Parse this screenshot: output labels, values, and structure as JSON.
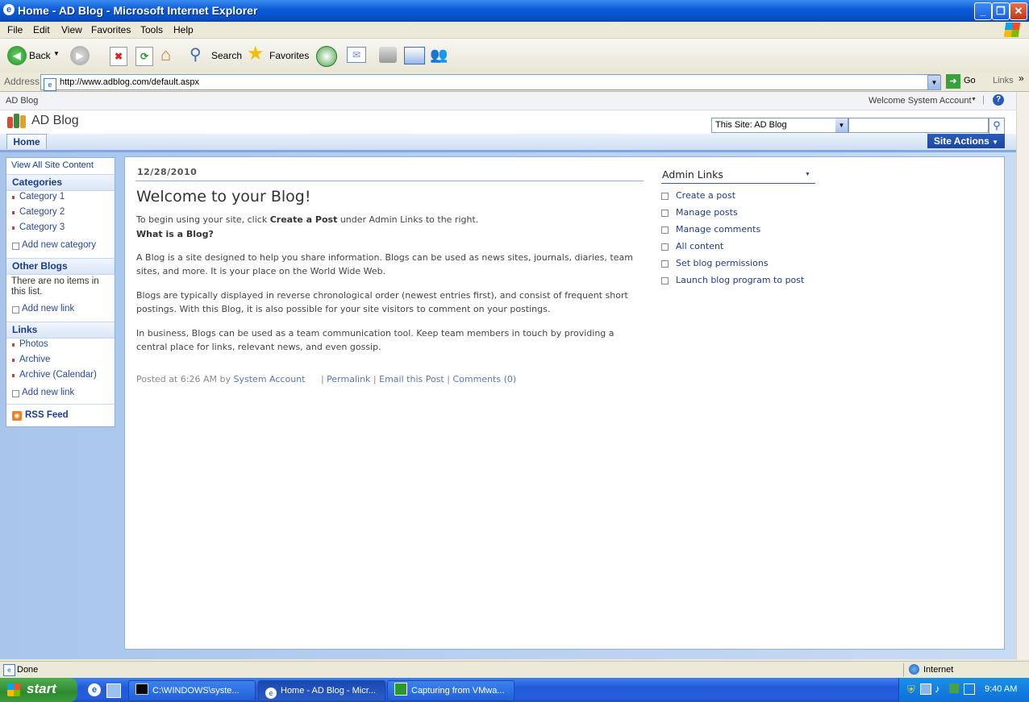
{
  "window": {
    "title": "Home - AD Blog - Microsoft Internet Explorer"
  },
  "menu": [
    "File",
    "Edit",
    "View",
    "Favorites",
    "Tools",
    "Help"
  ],
  "toolbar": {
    "back": "Back",
    "search": "Search",
    "favorites": "Favorites"
  },
  "address": {
    "label": "Address",
    "url": "http://www.adblog.com/default.aspx",
    "go": "Go",
    "links": "Links"
  },
  "site": {
    "breadcrumb": "AD Blog",
    "welcome": "Welcome System Account",
    "title": "AD Blog",
    "scope": "This Site: AD Blog",
    "home_tab": "Home",
    "site_actions": "Site Actions"
  },
  "nav": {
    "view_all": "View All Site Content",
    "categories_head": "Categories",
    "categories": [
      "Category 1",
      "Category 2",
      "Category 3"
    ],
    "add_category": "Add new category",
    "other_blogs_head": "Other Blogs",
    "no_items": "There are no items in this list.",
    "add_link": "Add new link",
    "links_head": "Links",
    "links": [
      "Photos",
      "Archive",
      "Archive (Calendar)"
    ],
    "add_link2": "Add new link",
    "rss": "RSS Feed"
  },
  "post": {
    "date": "12/28/2010",
    "title": "Welcome to your Blog!",
    "intro_a": "To begin using your site, click ",
    "intro_b": "Create a Post",
    "intro_c": " under Admin Links to the right.",
    "what_is": "What is a Blog?",
    "p1": "A Blog is a site designed to help you share information. Blogs can be used as news sites, journals, diaries, team sites, and more. It is your place on the World Wide Web.",
    "p2": "Blogs are typically displayed in reverse chronological order (newest entries first), and consist of frequent short postings. With this Blog, it is also possible for your site visitors to comment on your postings.",
    "p3": "In business, Blogs can be used as a team communication tool. Keep team members in touch by providing a central place for links, relevant news, and even gossip.",
    "posted_at": "Posted at 6:26 AM by",
    "author": "System Account",
    "permalink": "Permalink",
    "email": "Email this Post",
    "comments": "Comments (0)"
  },
  "admin": {
    "title": "Admin Links",
    "links": [
      "Create a post",
      "Manage posts",
      "Manage comments",
      "All content",
      "Set blog permissions",
      "Launch blog program to post"
    ]
  },
  "status": {
    "text": "Done",
    "zone": "Internet"
  },
  "taskbar": {
    "start": "start",
    "tasks": [
      "C:\\WINDOWS\\syste...",
      "Home - AD Blog - Micr...",
      "Capturing from VMwa..."
    ],
    "time": "9:40 AM"
  }
}
